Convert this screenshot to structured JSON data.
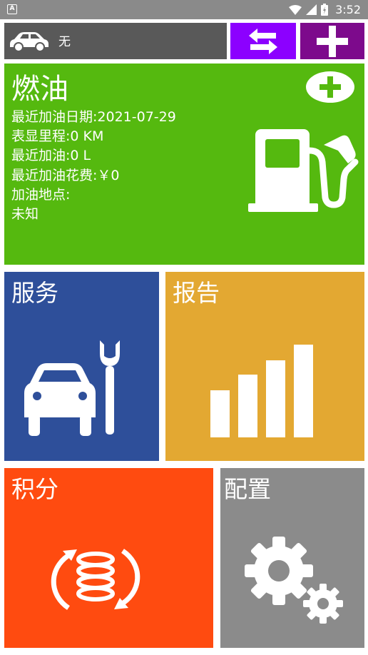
{
  "status_bar": {
    "time": "3:52",
    "notification_badge": "A"
  },
  "vehicle": {
    "name": "无"
  },
  "fuel": {
    "title": "燃油",
    "recent_date": "最近加油日期:2021-07-29",
    "odometer": "表显里程:0 KM",
    "recent_amount": "最近加油:0 L",
    "recent_cost": "最近加油花费:￥0",
    "location_label": "加油地点:",
    "location_value": "未知"
  },
  "tiles": {
    "service": "服务",
    "report": "报告",
    "points": "积分",
    "config": "配置"
  },
  "colors": {
    "fuel": "#55b90f",
    "service": "#2e4f9a",
    "report": "#e3a832",
    "points": "#ff4b10",
    "config": "#8b8b8b",
    "switch_button": "#8c00ff",
    "add_button": "#7d0a8c",
    "car_bar": "#595959"
  },
  "icons": {
    "car": "car-icon",
    "switch": "swap-arrows-icon",
    "add": "plus-icon",
    "fuel_add": "circle-plus-icon",
    "fuel": "fuel-pump-icon",
    "service": "car-wrench-icon",
    "report": "bar-chart-icon",
    "points": "coins-cycle-icon",
    "config": "gears-icon"
  }
}
